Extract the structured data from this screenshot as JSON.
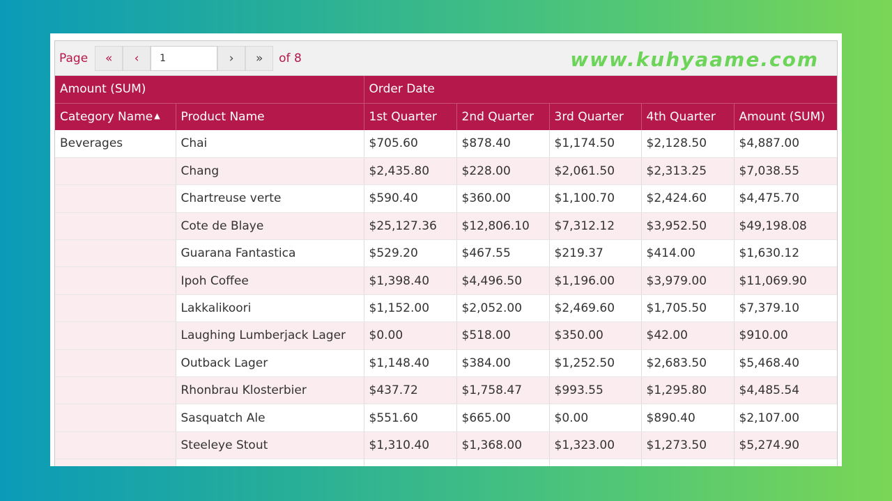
{
  "pager": {
    "page_label": "Page",
    "first_icon": "«",
    "prev_icon": "‹",
    "current_page": "1",
    "next_icon": "›",
    "last_icon": "»",
    "of_label": "of 8"
  },
  "watermark": "www.kuhyaame.com",
  "header": {
    "amount_sum": "Amount (SUM)",
    "order_date": "Order Date",
    "category_name": "Category Name",
    "sort_icon": "▲",
    "product_name": "Product Name",
    "q1": "1st Quarter",
    "q2": "2nd Quarter",
    "q3": "3rd Quarter",
    "q4": "4th Quarter",
    "total": "Amount (SUM)"
  },
  "rows": [
    {
      "category": "Beverages",
      "product": "Chai",
      "q1": "$705.60",
      "q2": "$878.40",
      "q3": "$1,174.50",
      "q4": "$2,128.50",
      "total": "$4,887.00"
    },
    {
      "category": "",
      "product": "Chang",
      "q1": "$2,435.80",
      "q2": "$228.00",
      "q3": "$2,061.50",
      "q4": "$2,313.25",
      "total": "$7,038.55"
    },
    {
      "category": "",
      "product": "Chartreuse verte",
      "q1": "$590.40",
      "q2": "$360.00",
      "q3": "$1,100.70",
      "q4": "$2,424.60",
      "total": "$4,475.70"
    },
    {
      "category": "",
      "product": "Cote de Blaye",
      "q1": "$25,127.36",
      "q2": "$12,806.10",
      "q3": "$7,312.12",
      "q4": "$3,952.50",
      "total": "$49,198.08"
    },
    {
      "category": "",
      "product": "Guarana Fantastica",
      "q1": "$529.20",
      "q2": "$467.55",
      "q3": "$219.37",
      "q4": "$414.00",
      "total": "$1,630.12"
    },
    {
      "category": "",
      "product": "Ipoh Coffee",
      "q1": "$1,398.40",
      "q2": "$4,496.50",
      "q3": "$1,196.00",
      "q4": "$3,979.00",
      "total": "$11,069.90"
    },
    {
      "category": "",
      "product": "Lakkalikoori",
      "q1": "$1,152.00",
      "q2": "$2,052.00",
      "q3": "$2,469.60",
      "q4": "$1,705.50",
      "total": "$7,379.10"
    },
    {
      "category": "",
      "product": "Laughing Lumberjack Lager",
      "q1": "$0.00",
      "q2": "$518.00",
      "q3": "$350.00",
      "q4": "$42.00",
      "total": "$910.00"
    },
    {
      "category": "",
      "product": "Outback Lager",
      "q1": "$1,148.40",
      "q2": "$384.00",
      "q3": "$1,252.50",
      "q4": "$2,683.50",
      "total": "$5,468.40"
    },
    {
      "category": "",
      "product": "Rhonbrau Klosterbier",
      "q1": "$437.72",
      "q2": "$1,758.47",
      "q3": "$993.55",
      "q4": "$1,295.80",
      "total": "$4,485.54"
    },
    {
      "category": "",
      "product": "Sasquatch Ale",
      "q1": "$551.60",
      "q2": "$665.00",
      "q3": "$0.00",
      "q4": "$890.40",
      "total": "$2,107.00"
    },
    {
      "category": "",
      "product": "Steeleye Stout",
      "q1": "$1,310.40",
      "q2": "$1,368.00",
      "q3": "$1,323.00",
      "q4": "$1,273.50",
      "total": "$5,274.90"
    },
    {
      "category": "",
      "product": "",
      "q1": "",
      "q2": "",
      "q3": "",
      "q4": "",
      "total": ""
    }
  ],
  "colors": {
    "header_bg": "#b5184a",
    "row_alt": "#fbecef",
    "accent_text": "#b5184a",
    "watermark": "#6dd45a"
  }
}
